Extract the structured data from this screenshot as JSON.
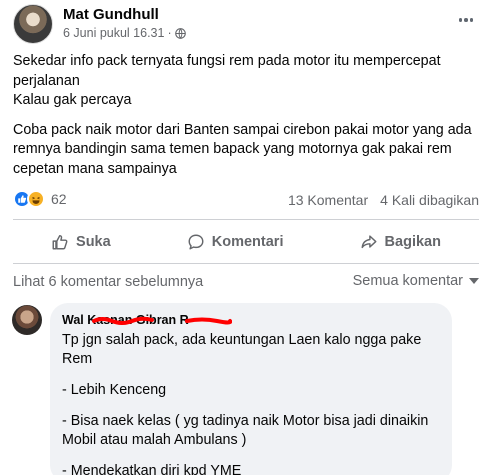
{
  "post": {
    "author": "Mat Gundhull",
    "timestamp": "6 Juni pukul 16.31",
    "separator": "·",
    "privacy_icon": "globe-icon",
    "more_icon": "more-horizontal-icon",
    "paragraphs": [
      "Sekedar info pack ternyata fungsi rem pada motor itu mempercepat perjalanan",
      "Kalau gak percaya",
      "Coba pack naik motor dari Banten sampai cirebon pakai motor yang ada remnya bandingin sama temen bapack yang motornya gak pakai rem cepetan mana sampainya"
    ]
  },
  "stats": {
    "reaction_count": "62",
    "reaction_icons": [
      "like-reaction-icon",
      "haha-reaction-icon"
    ],
    "comments": "13 Komentar",
    "shares": "4 Kali dibagikan"
  },
  "actions": {
    "like": "Suka",
    "comment": "Komentari",
    "share": "Bagikan"
  },
  "comments_section": {
    "see_previous": "Lihat 6 komentar sebelumnya",
    "sort_label": "Semua komentar",
    "comment": {
      "author": "Wal     Kasnan Gibran R",
      "lines": [
        "Tp jgn salah pack, ada keuntungan Laen kalo ngga pake Rem",
        "- Lebih Kenceng",
        "- Bisa naek kelas ( yg tadinya naik Motor bisa jadi dinaikin Mobil atau malah Ambulans )",
        "- Mendekatkan diri kpd YME"
      ]
    }
  },
  "colors": {
    "primary_text": "#050505",
    "secondary_text": "#65676b",
    "like_blue": "#1877f2",
    "bubble_bg": "#f0f2f5",
    "redaction_red": "#ff0000"
  }
}
